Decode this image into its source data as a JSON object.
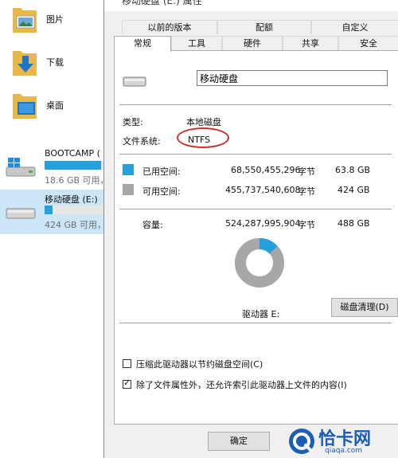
{
  "explorer": {
    "folders": [
      {
        "label": "图片",
        "icon": "pictures-folder-icon"
      },
      {
        "label": "下载",
        "icon": "downloads-folder-icon"
      },
      {
        "label": "桌面",
        "icon": "desktop-folder-icon"
      }
    ],
    "drives": [
      {
        "name": "BOOTCAMP (",
        "size": "18.6 GB 可用，",
        "icon": "windows-drive-icon",
        "used_fraction": 0.9
      },
      {
        "name": "移动硬盘 (E:)",
        "size": "424 GB 可用，",
        "icon": "removable-drive-icon",
        "used_fraction": 0.13
      }
    ]
  },
  "dialog": {
    "title": "移动硬盘 (E:) 属性",
    "tabs_top": [
      "以前的版本",
      "配额",
      "自定义"
    ],
    "tabs_bottom": [
      "常规",
      "工具",
      "硬件",
      "共享",
      "安全"
    ],
    "active_tab": "常规",
    "name_value": "移动硬盘",
    "type_label": "类型:",
    "type_value": "本地磁盘",
    "fs_label": "文件系统:",
    "fs_value": "NTFS",
    "used": {
      "label": "已用空间:",
      "bytes": "68,550,455,296",
      "unit": "字节",
      "gb": "63.8 GB",
      "color": "#26a0da"
    },
    "free": {
      "label": "可用空间:",
      "bytes": "455,737,540,608",
      "unit": "字节",
      "gb": "424 GB",
      "color": "#a7a7a7"
    },
    "capacity": {
      "label": "容量:",
      "bytes": "524,287,995,904",
      "unit": "字节",
      "gb": "488 GB"
    },
    "used_fraction": 0.131,
    "drive_label": "驱动器 E:",
    "cleanup_button": "磁盘清理(D)",
    "compress_label": "压缩此驱动器以节约磁盘空间(C)",
    "compress_checked": false,
    "index_label": "除了文件属性外，还允许索引此驱动器上文件的内容(I)",
    "index_checked": true,
    "ok_button": "确定"
  },
  "watermark": {
    "text": "恰卡网",
    "url": "qiaqa.com",
    "color": "#1a5fb4"
  }
}
